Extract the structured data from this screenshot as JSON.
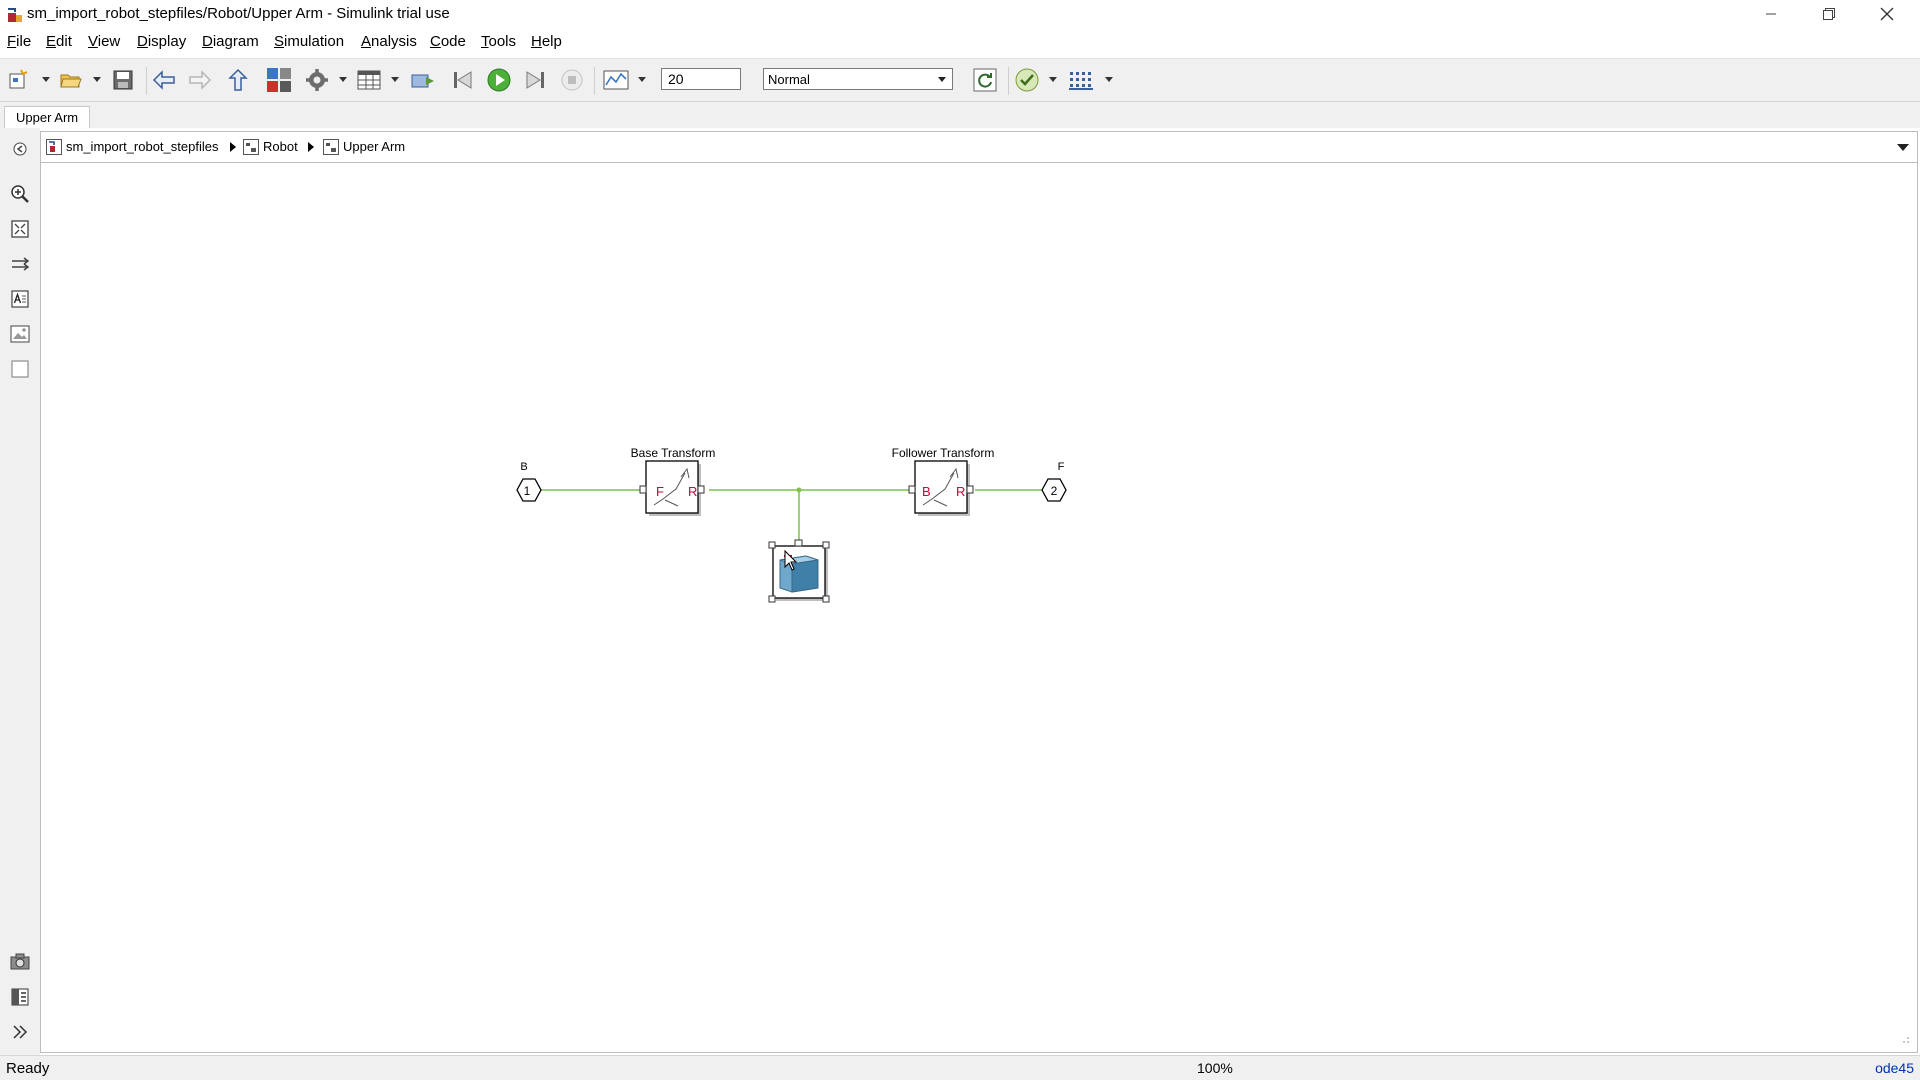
{
  "window": {
    "title": "sm_import_robot_stepfiles/Robot/Upper Arm - Simulink trial use"
  },
  "menu": {
    "items": [
      {
        "mnemonic": "F",
        "rest": "ile"
      },
      {
        "mnemonic": "E",
        "rest": "dit"
      },
      {
        "mnemonic": "V",
        "rest": "iew"
      },
      {
        "mnemonic": "D",
        "rest": "isplay"
      },
      {
        "mnemonic": "D",
        "rest": "iagram"
      },
      {
        "mnemonic": "S",
        "rest": "imulation"
      },
      {
        "mnemonic": "A",
        "rest": "nalysis"
      },
      {
        "mnemonic": "C",
        "rest": "ode"
      },
      {
        "mnemonic": "T",
        "rest": "ools"
      },
      {
        "mnemonic": "H",
        "rest": "elp"
      }
    ]
  },
  "toolbar": {
    "stop_time": "20",
    "sim_mode": "Normal"
  },
  "tabs": [
    {
      "label": "Upper Arm"
    }
  ],
  "breadcrumb": {
    "items": [
      {
        "label": "sm_import_robot_stepfiles"
      },
      {
        "label": "Robot"
      },
      {
        "label": "Upper Arm"
      }
    ]
  },
  "diagram": {
    "port_b_name": "B",
    "port_b_number": "1",
    "port_f_name": "F",
    "port_f_number": "2",
    "base_transform_label": "Base Transform",
    "follower_transform_label": "Follower Transform",
    "transform_port_b": "B",
    "transform_port_f": "F",
    "line_color": "#7fc34a",
    "port_mark_color": "#d0003c"
  },
  "status": {
    "ready": "Ready",
    "zoom": "100%",
    "solver": "ode45"
  }
}
